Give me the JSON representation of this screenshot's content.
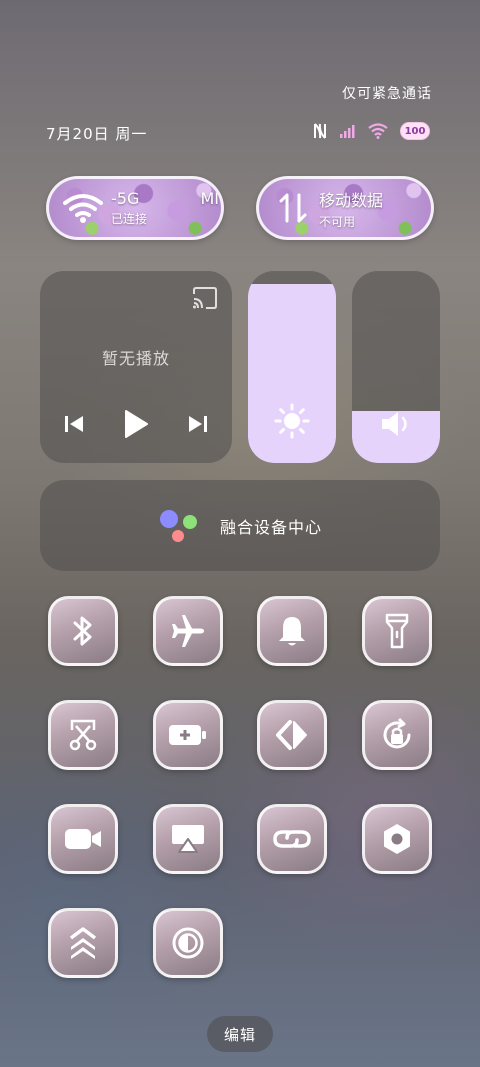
{
  "status_bar": {
    "emergency_text": "仅可紧急通话",
    "date": "7月20日 周一",
    "battery": "100"
  },
  "wifi_tile": {
    "title": "-5G",
    "ssid_partial": "MI",
    "subtitle": "已连接"
  },
  "mobile_tile": {
    "title": "移动数据",
    "subtitle": "不可用"
  },
  "media": {
    "status": "暂无播放"
  },
  "brightness": {
    "level": 0.93
  },
  "volume": {
    "level": 0.27
  },
  "devices": {
    "label": "融合设备中心"
  },
  "toggles": [
    {
      "name": "bluetooth",
      "icon": "bluetooth-icon",
      "active": true
    },
    {
      "name": "airplane-mode",
      "icon": "airplane-icon",
      "active": false
    },
    {
      "name": "do-not-disturb",
      "icon": "bell-icon",
      "active": false
    },
    {
      "name": "flashlight",
      "icon": "flashlight-icon",
      "active": false
    },
    {
      "name": "screenshot",
      "icon": "scissors-icon",
      "active": false
    },
    {
      "name": "battery-saver",
      "icon": "battery-plus-icon",
      "active": false
    },
    {
      "name": "nearby-share",
      "icon": "share-arrows-icon",
      "active": false
    },
    {
      "name": "rotation-lock",
      "icon": "rotation-lock-icon",
      "active": true
    },
    {
      "name": "screen-record",
      "icon": "video-camera-icon",
      "active": false
    },
    {
      "name": "screen-cast",
      "icon": "cast-screen-icon",
      "active": false
    },
    {
      "name": "link",
      "icon": "link-icon",
      "active": false
    },
    {
      "name": "settings",
      "icon": "hex-nut-icon",
      "active": false
    },
    {
      "name": "performance-mode",
      "icon": "chevrons-up-icon",
      "active": true
    },
    {
      "name": "dark-mode",
      "icon": "contrast-icon",
      "active": false
    }
  ],
  "edit_label": "编辑",
  "colors": {
    "accent": "#e5d3fb",
    "panel": "#504e4e"
  }
}
